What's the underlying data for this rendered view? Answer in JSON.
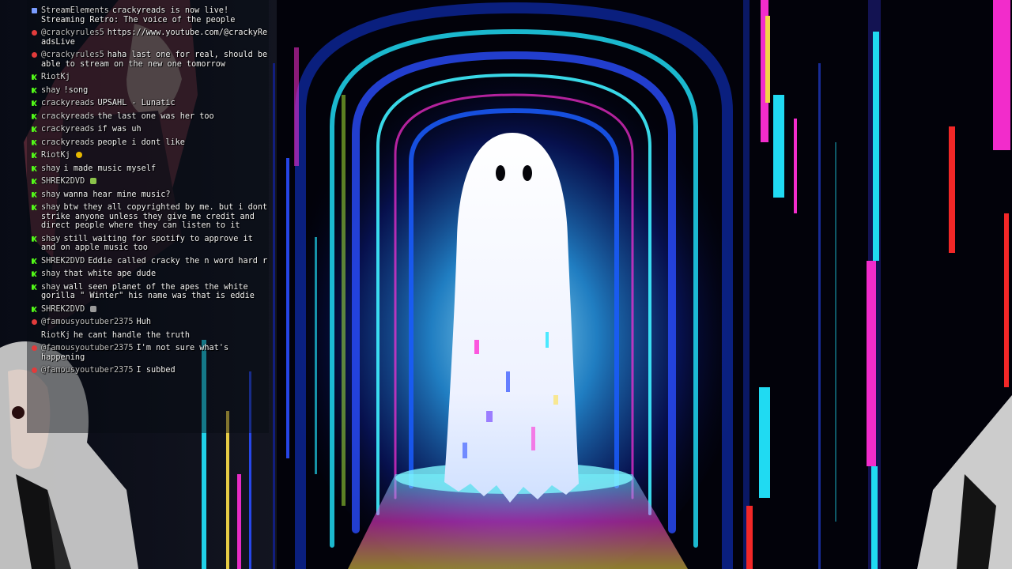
{
  "chat": {
    "messages": [
      {
        "platform": "se",
        "user": "StreamElements",
        "text": "crackyreads is now live! Streaming Retro: The voice of the people",
        "emote": ""
      },
      {
        "platform": "yt",
        "user": "@crackyrules5",
        "text": "https://www.youtube.com/@crackyReadsLive",
        "emote": ""
      },
      {
        "platform": "yt",
        "user": "@crackyrules5",
        "text": "haha last one for real, should be able to stream on the new one tomorrow",
        "emote": ""
      },
      {
        "platform": "kick",
        "user": "RiotKj",
        "text": "",
        "emote": ""
      },
      {
        "platform": "kick",
        "user": "shay",
        "text": "!song",
        "emote": ""
      },
      {
        "platform": "kick",
        "user": "crackyreads",
        "text": "UPSAHL - Lunatic",
        "emote": ""
      },
      {
        "platform": "kick",
        "user": "crackyreads",
        "text": "the last one was her too",
        "emote": ""
      },
      {
        "platform": "kick",
        "user": "crackyreads",
        "text": "if was uh",
        "emote": ""
      },
      {
        "platform": "kick",
        "user": "crackyreads",
        "text": "people i dont like",
        "emote": ""
      },
      {
        "platform": "kick",
        "user": "RiotKj",
        "text": "",
        "emote": "yellow"
      },
      {
        "platform": "kick",
        "user": "shay",
        "text": "i made music myself",
        "emote": ""
      },
      {
        "platform": "kick",
        "user": "SHREK2DVD",
        "text": "",
        "emote": "green"
      },
      {
        "platform": "kick",
        "user": "shay",
        "text": "wanna hear mine music?",
        "emote": ""
      },
      {
        "platform": "kick",
        "user": "shay",
        "text": "btw they all copyrighted by me. but i dont strike anyone unless they give me credit and direct people where they can listen to it",
        "emote": ""
      },
      {
        "platform": "kick",
        "user": "shay",
        "text": "still waiting for spotify to approve it and on apple music too",
        "emote": ""
      },
      {
        "platform": "kick",
        "user": "SHREK2DVD",
        "text": "Eddie called cracky the n word hard r",
        "emote": ""
      },
      {
        "platform": "kick",
        "user": "shay",
        "text": "that white ape dude",
        "emote": ""
      },
      {
        "platform": "kick",
        "user": "shay",
        "text": "wall seen planet of the apes the white gorilla \" Winter\" his name was that is eddie",
        "emote": ""
      },
      {
        "platform": "kick",
        "user": "SHREK2DVD",
        "text": "",
        "emote": "grey"
      },
      {
        "platform": "yt",
        "user": "@famousyoutuber2375",
        "text": "Huh",
        "emote": ""
      },
      {
        "platform": "none",
        "user": "RiotKj",
        "text": "he cant handle the truth",
        "emote": ""
      },
      {
        "platform": "yt",
        "user": "@famousyoutuber2375",
        "text": "I'm not sure what's happening",
        "emote": ""
      },
      {
        "platform": "yt",
        "user": "@famousyoutuber2375",
        "text": "I subbed",
        "emote": ""
      }
    ]
  },
  "colors": {
    "neon_cyan": "#22e6ff",
    "neon_magenta": "#ff2fd6",
    "neon_blue": "#2a4dff",
    "neon_yellow": "#ffe14a",
    "neon_red": "#ff2a2a",
    "ghost_white": "#f4f6ff"
  },
  "icons": {
    "kick": "kick-badge-icon",
    "youtube": "youtube-badge-icon",
    "streamelements": "streamelements-badge-icon"
  }
}
